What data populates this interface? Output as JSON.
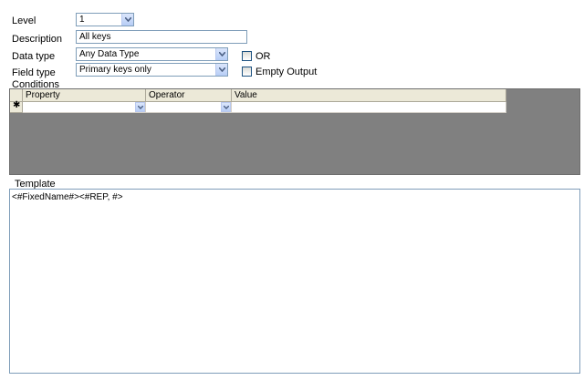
{
  "form": {
    "level": {
      "label": "Level",
      "value": "1"
    },
    "description": {
      "label": "Description",
      "value": "All keys"
    },
    "data_type": {
      "label": "Data type",
      "value": "Any Data Type"
    },
    "field_type": {
      "label": "Field type",
      "value": "Primary keys only"
    },
    "or_checkbox": {
      "label": "OR",
      "checked": false
    },
    "empty_output_checkbox": {
      "label": "Empty Output",
      "checked": false
    }
  },
  "conditions": {
    "label": "Conditions",
    "columns": [
      "Property",
      "Operator",
      "Value"
    ],
    "new_row_marker": "✱",
    "rows": [
      {
        "property": "",
        "operator": "",
        "value": ""
      }
    ]
  },
  "template": {
    "label": "Template",
    "content": "<#FixedName#><#REP, #>"
  },
  "icons": {
    "dropdown": "chevron-down-icon",
    "new_row": "asterisk-icon"
  },
  "colors": {
    "grid_background": "#808080",
    "border": "#7f9db9",
    "header_background": "#ece9d8"
  }
}
